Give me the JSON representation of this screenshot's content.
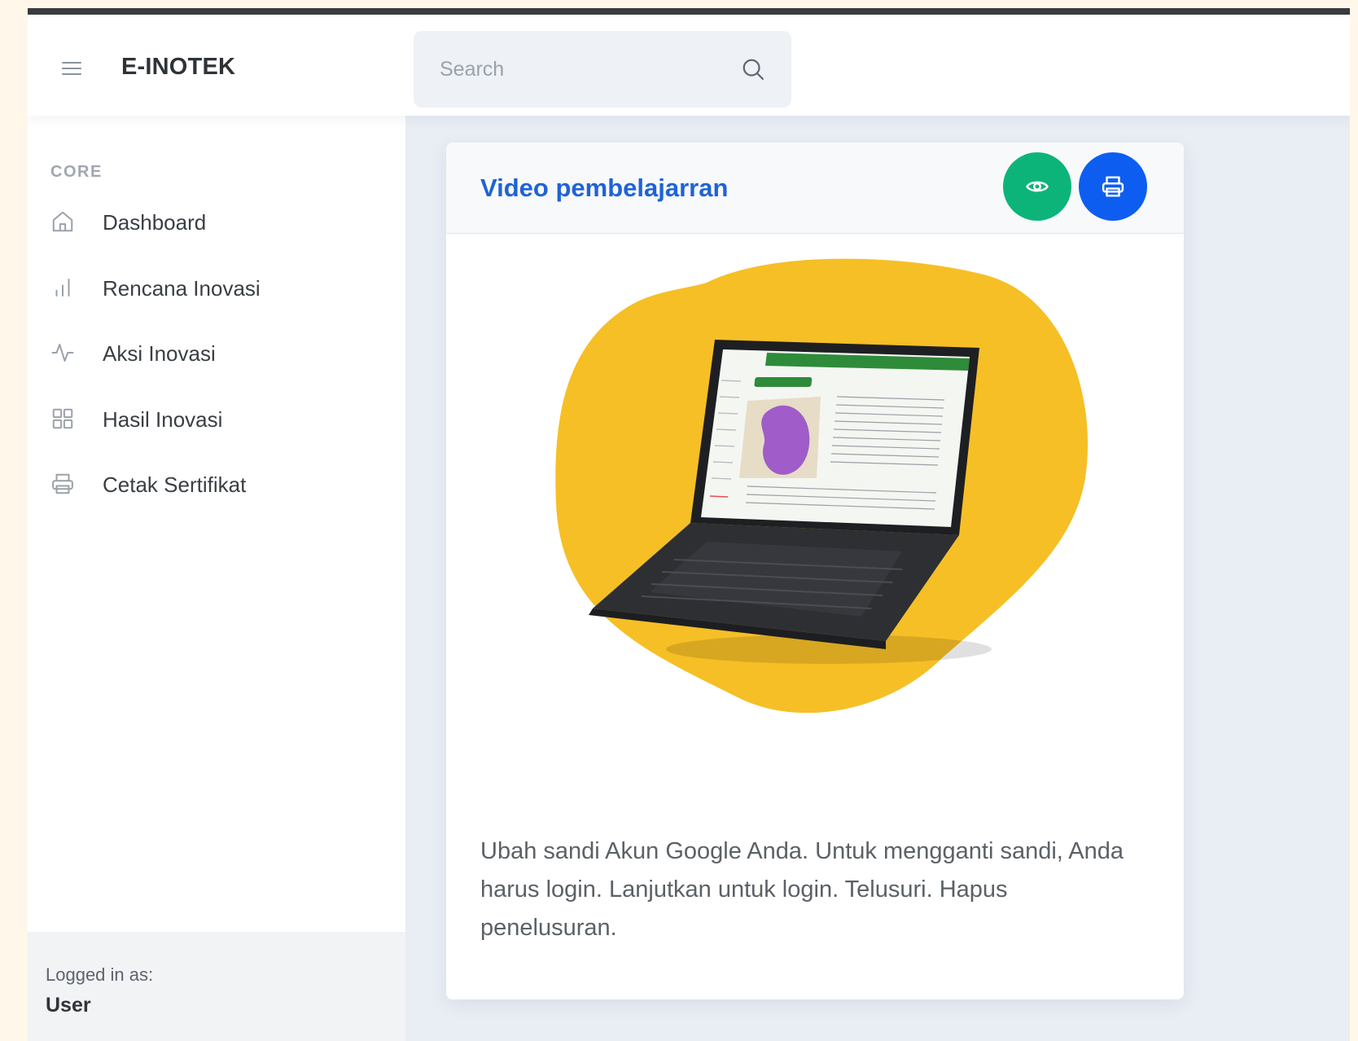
{
  "app": {
    "brand": "E-INOTEK"
  },
  "search": {
    "placeholder": "Search"
  },
  "sidebar": {
    "heading": "CORE",
    "items": [
      {
        "label": "Dashboard",
        "icon": "home-icon"
      },
      {
        "label": "Rencana Inovasi",
        "icon": "bar-chart-icon"
      },
      {
        "label": "Aksi Inovasi",
        "icon": "activity-icon"
      },
      {
        "label": "Hasil Inovasi",
        "icon": "grid-icon"
      },
      {
        "label": "Cetak Sertifikat",
        "icon": "printer-icon"
      }
    ],
    "footer": {
      "logged_in_label": "Logged in as:",
      "username": "User"
    }
  },
  "card": {
    "title": "Video pembelajarran",
    "description": "Ubah sandi Akun Google Anda. Untuk mengganti sandi, Anda harus login. Lanjutkan untuk login. Telusuri. Hapus penelusuran.",
    "buttons": {
      "view_icon": "eye-icon",
      "print_icon": "printer-icon"
    }
  },
  "colors": {
    "accent_blue": "#1f63d6",
    "view_button": "#0db47a",
    "print_button": "#0d5ef0",
    "blob_yellow": "#f6bf26",
    "screen_green": "#2e8b3a"
  }
}
